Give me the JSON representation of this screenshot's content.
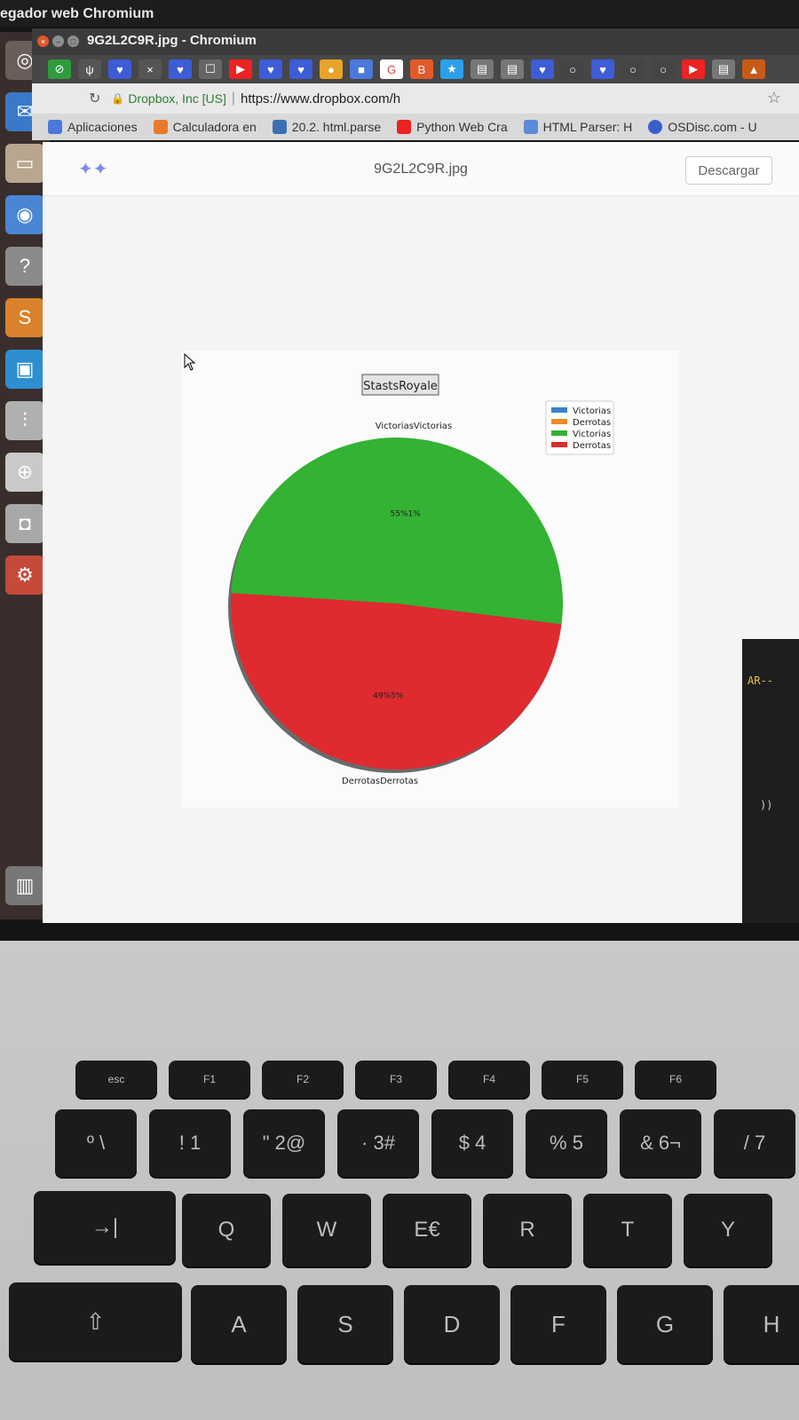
{
  "os": {
    "window_title": "egador web Chromium"
  },
  "browser": {
    "title": "9G2L2C9R.jpg - Chromium",
    "tabs": [
      "⊘",
      "ψ",
      "♥",
      "×",
      "♥",
      "☐",
      "▶",
      "♥",
      "♥",
      "●",
      "■",
      "G",
      "B",
      "★",
      "▤",
      "▤",
      "♥",
      "○",
      "♥",
      "○",
      "○",
      "▶",
      "▤",
      "▲"
    ],
    "address": {
      "site": "Dropbox, Inc [US]",
      "url": "https://www.dropbox.com/h"
    },
    "bookmarks": [
      "Aplicaciones",
      "Calculadora en",
      "20.2. html.parse",
      "Python Web Cra",
      "HTML Parser: H",
      "OSDisc.com - U"
    ]
  },
  "dropbox": {
    "filename": "9G2L2C9R.jpg",
    "download_label": "Descargar"
  },
  "terminal": {
    "line1": "AR--",
    "line2": "))"
  },
  "chart_data": {
    "type": "pie",
    "title": "StastsRoyale",
    "legend": [
      "Victorias",
      "Derrotas",
      "Victorias",
      "Derrotas"
    ],
    "legend_colors": [
      "#3f7fc8",
      "#f0892a",
      "#33b233",
      "#df2a2f"
    ],
    "legend_placement": "top-right",
    "slices": [
      {
        "label": "Victorias",
        "value": 51,
        "color": "#33b233",
        "pct_label": "55%1%",
        "outer_label": "VictoriasVictorias"
      },
      {
        "label": "Derrotas",
        "value": 49,
        "color": "#df2a2f",
        "pct_label": "49%5%",
        "outer_label": "DerrotasDerrotas"
      }
    ]
  },
  "keyboard": {
    "fn_row": [
      "esc",
      "F1",
      "F2",
      "F3",
      "F4",
      "F5",
      "F6"
    ],
    "num_row": [
      "º \\",
      "! 1",
      "\" 2@",
      "· 3#",
      "$ 4",
      "% 5",
      "& 6¬",
      "/ 7"
    ],
    "qwerty_row": [
      "→|",
      "Q",
      "W",
      "E€",
      "R",
      "T",
      "Y"
    ],
    "home_row": [
      "⇧",
      "A",
      "S",
      "D",
      "F",
      "G",
      "H"
    ]
  }
}
